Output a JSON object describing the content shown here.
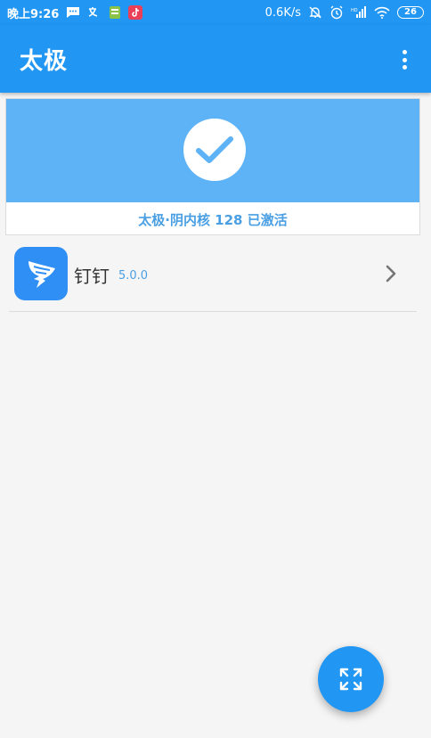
{
  "status_bar": {
    "time": "晚上9:26",
    "network_speed": "0.6K/s",
    "battery": "26",
    "icons": [
      "message-icon",
      "translate-icon",
      "app-notification-icon",
      "tiktok-icon",
      "mute-icon",
      "alarm-icon",
      "hd-signal-icon",
      "wifi-icon",
      "battery-icon"
    ]
  },
  "app_bar": {
    "title": "太极"
  },
  "status_card": {
    "text": "太极·阴内核 128 已激活"
  },
  "modules": [
    {
      "name": "钉钉",
      "version": "5.0.0"
    }
  ],
  "colors": {
    "primary": "#2196f3",
    "status_banner": "#5eb3f7",
    "accent_text": "#4a9fe3",
    "module_icon": "#2f8ff5"
  }
}
